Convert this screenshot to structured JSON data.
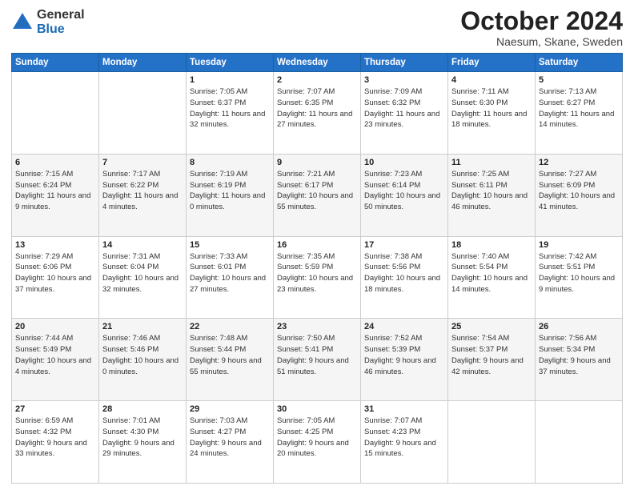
{
  "logo": {
    "general": "General",
    "blue": "Blue"
  },
  "header": {
    "month_year": "October 2024",
    "location": "Naesum, Skane, Sweden"
  },
  "days_of_week": [
    "Sunday",
    "Monday",
    "Tuesday",
    "Wednesday",
    "Thursday",
    "Friday",
    "Saturday"
  ],
  "weeks": [
    [
      {
        "day": "",
        "info": ""
      },
      {
        "day": "",
        "info": ""
      },
      {
        "day": "1",
        "info": "Sunrise: 7:05 AM\nSunset: 6:37 PM\nDaylight: 11 hours and 32 minutes."
      },
      {
        "day": "2",
        "info": "Sunrise: 7:07 AM\nSunset: 6:35 PM\nDaylight: 11 hours and 27 minutes."
      },
      {
        "day": "3",
        "info": "Sunrise: 7:09 AM\nSunset: 6:32 PM\nDaylight: 11 hours and 23 minutes."
      },
      {
        "day": "4",
        "info": "Sunrise: 7:11 AM\nSunset: 6:30 PM\nDaylight: 11 hours and 18 minutes."
      },
      {
        "day": "5",
        "info": "Sunrise: 7:13 AM\nSunset: 6:27 PM\nDaylight: 11 hours and 14 minutes."
      }
    ],
    [
      {
        "day": "6",
        "info": "Sunrise: 7:15 AM\nSunset: 6:24 PM\nDaylight: 11 hours and 9 minutes."
      },
      {
        "day": "7",
        "info": "Sunrise: 7:17 AM\nSunset: 6:22 PM\nDaylight: 11 hours and 4 minutes."
      },
      {
        "day": "8",
        "info": "Sunrise: 7:19 AM\nSunset: 6:19 PM\nDaylight: 11 hours and 0 minutes."
      },
      {
        "day": "9",
        "info": "Sunrise: 7:21 AM\nSunset: 6:17 PM\nDaylight: 10 hours and 55 minutes."
      },
      {
        "day": "10",
        "info": "Sunrise: 7:23 AM\nSunset: 6:14 PM\nDaylight: 10 hours and 50 minutes."
      },
      {
        "day": "11",
        "info": "Sunrise: 7:25 AM\nSunset: 6:11 PM\nDaylight: 10 hours and 46 minutes."
      },
      {
        "day": "12",
        "info": "Sunrise: 7:27 AM\nSunset: 6:09 PM\nDaylight: 10 hours and 41 minutes."
      }
    ],
    [
      {
        "day": "13",
        "info": "Sunrise: 7:29 AM\nSunset: 6:06 PM\nDaylight: 10 hours and 37 minutes."
      },
      {
        "day": "14",
        "info": "Sunrise: 7:31 AM\nSunset: 6:04 PM\nDaylight: 10 hours and 32 minutes."
      },
      {
        "day": "15",
        "info": "Sunrise: 7:33 AM\nSunset: 6:01 PM\nDaylight: 10 hours and 27 minutes."
      },
      {
        "day": "16",
        "info": "Sunrise: 7:35 AM\nSunset: 5:59 PM\nDaylight: 10 hours and 23 minutes."
      },
      {
        "day": "17",
        "info": "Sunrise: 7:38 AM\nSunset: 5:56 PM\nDaylight: 10 hours and 18 minutes."
      },
      {
        "day": "18",
        "info": "Sunrise: 7:40 AM\nSunset: 5:54 PM\nDaylight: 10 hours and 14 minutes."
      },
      {
        "day": "19",
        "info": "Sunrise: 7:42 AM\nSunset: 5:51 PM\nDaylight: 10 hours and 9 minutes."
      }
    ],
    [
      {
        "day": "20",
        "info": "Sunrise: 7:44 AM\nSunset: 5:49 PM\nDaylight: 10 hours and 4 minutes."
      },
      {
        "day": "21",
        "info": "Sunrise: 7:46 AM\nSunset: 5:46 PM\nDaylight: 10 hours and 0 minutes."
      },
      {
        "day": "22",
        "info": "Sunrise: 7:48 AM\nSunset: 5:44 PM\nDaylight: 9 hours and 55 minutes."
      },
      {
        "day": "23",
        "info": "Sunrise: 7:50 AM\nSunset: 5:41 PM\nDaylight: 9 hours and 51 minutes."
      },
      {
        "day": "24",
        "info": "Sunrise: 7:52 AM\nSunset: 5:39 PM\nDaylight: 9 hours and 46 minutes."
      },
      {
        "day": "25",
        "info": "Sunrise: 7:54 AM\nSunset: 5:37 PM\nDaylight: 9 hours and 42 minutes."
      },
      {
        "day": "26",
        "info": "Sunrise: 7:56 AM\nSunset: 5:34 PM\nDaylight: 9 hours and 37 minutes."
      }
    ],
    [
      {
        "day": "27",
        "info": "Sunrise: 6:59 AM\nSunset: 4:32 PM\nDaylight: 9 hours and 33 minutes."
      },
      {
        "day": "28",
        "info": "Sunrise: 7:01 AM\nSunset: 4:30 PM\nDaylight: 9 hours and 29 minutes."
      },
      {
        "day": "29",
        "info": "Sunrise: 7:03 AM\nSunset: 4:27 PM\nDaylight: 9 hours and 24 minutes."
      },
      {
        "day": "30",
        "info": "Sunrise: 7:05 AM\nSunset: 4:25 PM\nDaylight: 9 hours and 20 minutes."
      },
      {
        "day": "31",
        "info": "Sunrise: 7:07 AM\nSunset: 4:23 PM\nDaylight: 9 hours and 15 minutes."
      },
      {
        "day": "",
        "info": ""
      },
      {
        "day": "",
        "info": ""
      }
    ]
  ]
}
